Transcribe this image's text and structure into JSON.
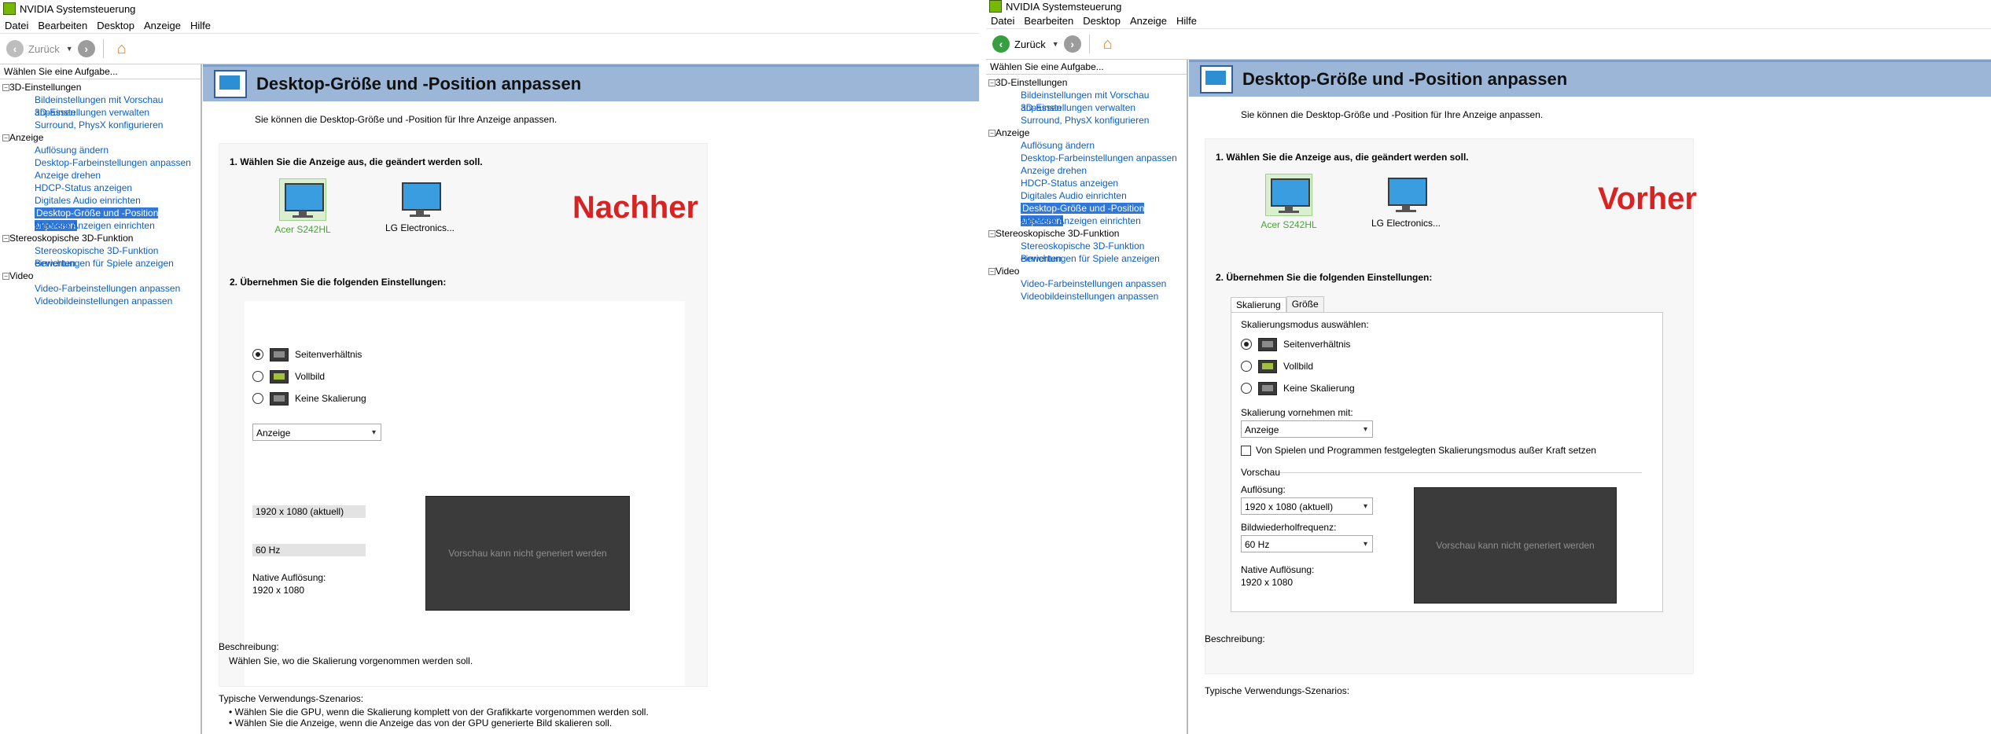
{
  "app": {
    "title": "NVIDIA Systemsteuerung"
  },
  "menu": [
    "Datei",
    "Bearbeiten",
    "Desktop",
    "Anzeige",
    "Hilfe"
  ],
  "toolbar": {
    "back_label": "Zurück"
  },
  "sidebar": {
    "header": "Wählen Sie eine Aufgabe...",
    "categories": [
      {
        "label": "3D-Einstellungen",
        "items": [
          "Bildeinstellungen mit Vorschau anpassen",
          "3D-Einstellungen verwalten",
          "Surround, PhysX konfigurieren"
        ]
      },
      {
        "label": "Anzeige",
        "items": [
          "Auflösung ändern",
          "Desktop-Farbeinstellungen anpassen",
          "Anzeige drehen",
          "HDCP-Status anzeigen",
          "Digitales Audio einrichten",
          "Desktop-Größe und -Position anpassen",
          "Mehrere Anzeigen einrichten"
        ]
      },
      {
        "label": "Stereoskopische 3D-Funktion",
        "items": [
          "Stereoskopische 3D-Funktion einrichten",
          "Bewertungen für Spiele anzeigen"
        ]
      },
      {
        "label": "Video",
        "items": [
          "Video-Farbeinstellungen anpassen",
          "Videobildeinstellungen anpassen"
        ]
      }
    ],
    "selected": "Desktop-Größe und -Position anpassen"
  },
  "page": {
    "title": "Desktop-Größe und -Position anpassen",
    "description": "Sie können die Desktop-Größe und -Position für Ihre Anzeige anpassen.",
    "step1": "1. Wählen Sie die Anzeige aus, die geändert werden soll.",
    "step2": "2. Übernehmen Sie die folgenden Einstellungen:",
    "monitors": [
      "Acer S242HL",
      "LG Electronics..."
    ],
    "tabs": [
      "Skalierung",
      "Größe"
    ],
    "scaling_mode_label": "Skalierungsmodus auswählen:",
    "options": [
      "Seitenverhältnis",
      "Vollbild",
      "Keine Skalierung"
    ],
    "scale_with_label": "Skalierung vornehmen mit:",
    "scale_with_value": "Anzeige",
    "override_label": "Von Spielen und Programmen festgelegten Skalierungsmodus außer Kraft setzen",
    "preview_label": "Vorschau",
    "resolution_label": "Auflösung:",
    "resolution_value": "1920 x 1080 (aktuell)",
    "refresh_label": "Bildwiederholfrequenz:",
    "refresh_value": "60 Hz",
    "native_label": "Native Auflösung:",
    "native_value": "1920 x 1080",
    "preview_text": "Vorschau kann nicht generiert werden",
    "beschreibung_label": "Beschreibung:",
    "beschreibung_text": "Wählen Sie, wo die Skalierung vorgenommen werden soll.",
    "scenarios_label": "Typische Verwendungs-Szenarios:",
    "scenarios": [
      "Wählen Sie die GPU, wenn die Skalierung komplett von der Grafikkarte vorgenommen werden soll.",
      "Wählen Sie die Anzeige, wenn die Anzeige das von der GPU generierte Bild skalieren soll."
    ]
  },
  "overlays": {
    "left": "Nachher",
    "right": "Vorher"
  },
  "colors": {
    "banner": "#9bb6d6",
    "link": "#0a5ec7",
    "overlay": "#d92323",
    "selected": "#2f77d9"
  }
}
